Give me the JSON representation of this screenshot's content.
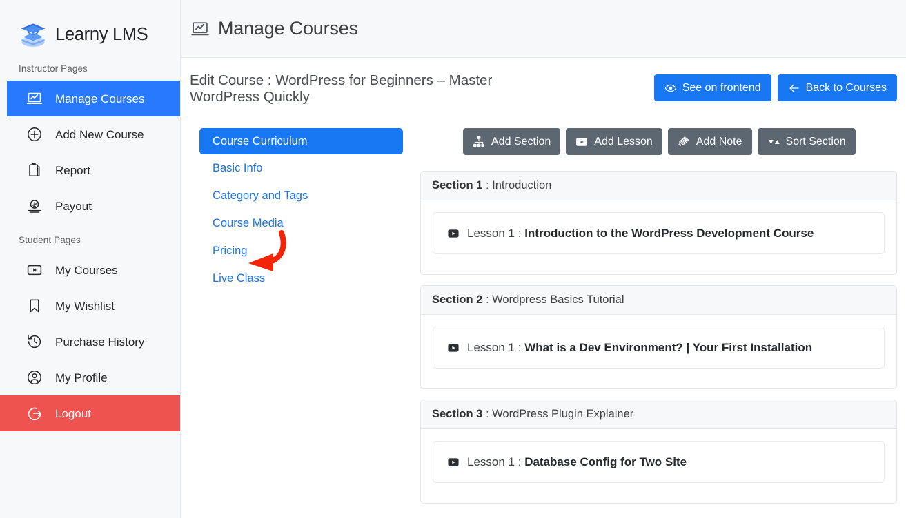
{
  "brand": {
    "name": "Learny LMS",
    "logo_icon": "graduation-cap-books-icon"
  },
  "sidebar": {
    "groups": [
      {
        "label": "Instructor Pages",
        "items": [
          {
            "label": "Manage Courses",
            "icon": "laptop-chart-icon",
            "active": true
          },
          {
            "label": "Add New Course",
            "icon": "plus-circle-icon",
            "active": false
          },
          {
            "label": "Report",
            "icon": "clipboard-icon",
            "active": false
          },
          {
            "label": "Payout",
            "icon": "money-hand-icon",
            "active": false
          }
        ]
      },
      {
        "label": "Student Pages",
        "items": [
          {
            "label": "My Courses",
            "icon": "play-rect-icon",
            "active": false
          },
          {
            "label": "My Wishlist",
            "icon": "bookmark-icon",
            "active": false
          },
          {
            "label": "Purchase History",
            "icon": "clock-history-icon",
            "active": false
          },
          {
            "label": "My Profile",
            "icon": "user-circle-icon",
            "active": false
          }
        ]
      }
    ],
    "logout": {
      "label": "Logout",
      "icon": "logout-arrow-icon"
    }
  },
  "header": {
    "title": "Manage Courses",
    "icon": "laptop-chart-icon"
  },
  "subheader": {
    "course_title": "Edit Course : WordPress for Beginners – Master WordPress Quickly",
    "see_frontend_label": "See on frontend",
    "see_frontend_icon": "eye-icon",
    "back_label": "Back to Courses",
    "back_icon": "arrow-left-icon"
  },
  "tabs": [
    {
      "label": "Course Curriculum",
      "active": true
    },
    {
      "label": "Basic Info",
      "active": false
    },
    {
      "label": "Category and Tags",
      "active": false
    },
    {
      "label": "Course Media",
      "active": false
    },
    {
      "label": "Pricing",
      "active": false
    },
    {
      "label": "Live Class",
      "active": false
    }
  ],
  "annotation": {
    "type": "red-curved-arrow",
    "points_at": "Live Class",
    "color": "#f42406"
  },
  "toolbar": [
    {
      "label": "Add Section",
      "icon": "sitemap-icon"
    },
    {
      "label": "Add Lesson",
      "icon": "play-rect-icon"
    },
    {
      "label": "Add Note",
      "icon": "note-stack-icon"
    },
    {
      "label": "Sort Section",
      "icon": "sort-arrows-icon"
    }
  ],
  "sections": [
    {
      "number": "Section 1",
      "separator": ":",
      "name": "Introduction",
      "lessons": [
        {
          "number": "Lesson 1",
          "separator": ":",
          "title": "Introduction to the WordPress Development Course",
          "icon": "play-rect-icon"
        }
      ]
    },
    {
      "number": "Section 2",
      "separator": ":",
      "name": "Wordpress Basics Tutorial",
      "lessons": [
        {
          "number": "Lesson 1",
          "separator": ":",
          "title": "What is a Dev Environment? | Your First Installation",
          "icon": "play-rect-icon"
        }
      ]
    },
    {
      "number": "Section 3",
      "separator": ":",
      "name": "WordPress Plugin Explainer",
      "lessons": [
        {
          "number": "Lesson 1",
          "separator": ":",
          "title": "Database Config for Two Site",
          "icon": "play-rect-icon"
        }
      ]
    }
  ],
  "colors": {
    "accent_blue": "#1877f2",
    "active_nav_blue": "#2979ff",
    "logout_red": "#ef5350",
    "toolbar_gray": "#5d6771",
    "annotation_red": "#f42406",
    "sidebar_bg": "#f7f8fa",
    "panel_bg": "#f7f8f9"
  }
}
